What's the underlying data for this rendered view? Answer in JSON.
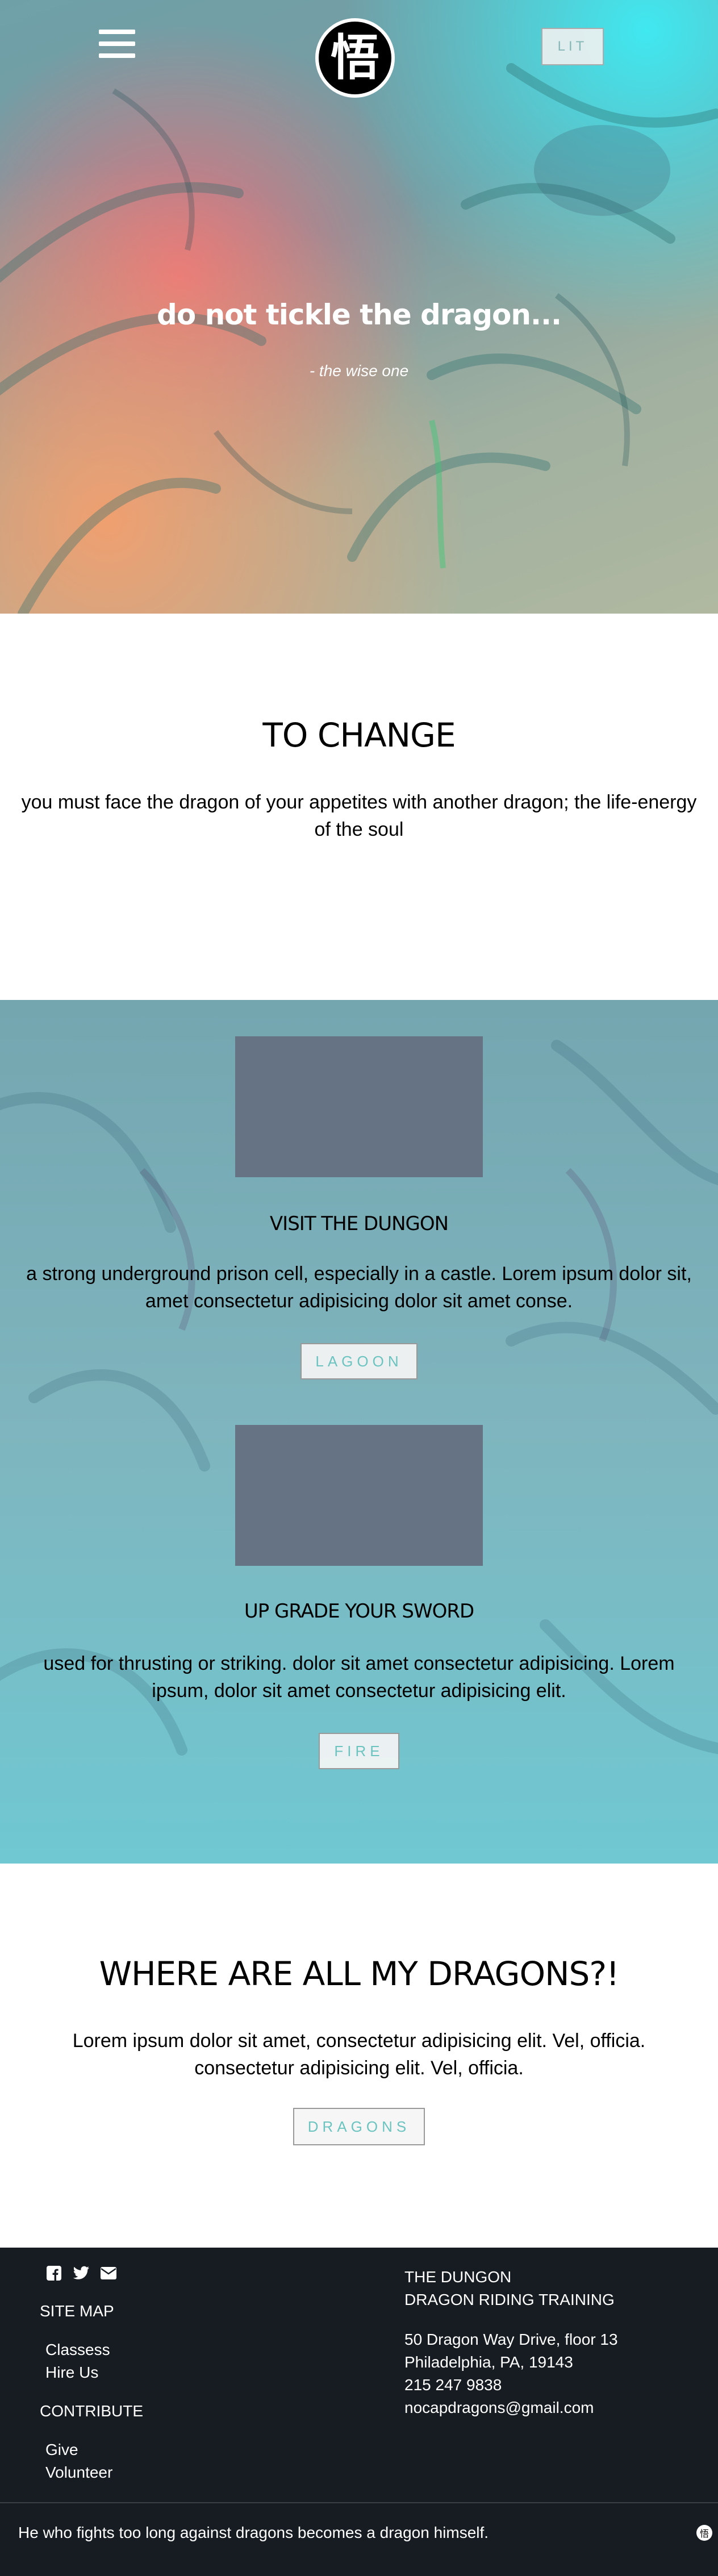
{
  "header": {
    "logo_glyph": "悟",
    "lit_label": "LIT",
    "title": "do not tickle the dragon...",
    "quote": "- the wise one"
  },
  "change": {
    "heading": "TO CHANGE",
    "text": "you must face the dragon of your appetites with another dragon; the life-energy of the soul"
  },
  "features": [
    {
      "heading": "VISIT THE DUNGON",
      "text": "a strong underground prison cell, especially in a castle. Lorem ipsum dolor sit, amet consectetur adipisicing dolor sit amet conse.",
      "button": "LAGOON"
    },
    {
      "heading": "UP GRADE YOUR SWORD",
      "text": "used for thrusting or striking. dolor sit amet consectetur adipisicing. Lorem ipsum, dolor sit amet consectetur adipisicing elit.",
      "button": "FIRE"
    }
  ],
  "dragons": {
    "heading": "WHERE ARE ALL MY DRAGONS?!",
    "text": "Lorem ipsum dolor sit amet, consectetur adipisicing elit. Vel, officia. consectetur adipisicing elit. Vel, officia.",
    "button": "DRAGONS"
  },
  "footer": {
    "icons": [
      "facebook-icon",
      "twitter-icon",
      "email-icon"
    ],
    "site_map": "SITE MAP",
    "site_map_links": [
      "Classess",
      "Hire Us"
    ],
    "contribute": "CONTRIBUTE",
    "contribute_links": [
      "Give",
      "Volunteer"
    ],
    "org_line1": "THE DUNGON",
    "org_line2": "DRAGON RIDING TRAINING",
    "address1": "50 Dragon Way Drive, floor 13",
    "address2": "Philadelphia, PA, 19143",
    "phone": "215 247 9838",
    "email": "nocapdragons@gmail.com"
  },
  "bottom": {
    "quote": "He who fights too long against dragons becomes a dragon himself."
  },
  "colors": {
    "footer_bg": "#171c22",
    "button_text": "#6cc4c0",
    "thumb": "#667384"
  }
}
